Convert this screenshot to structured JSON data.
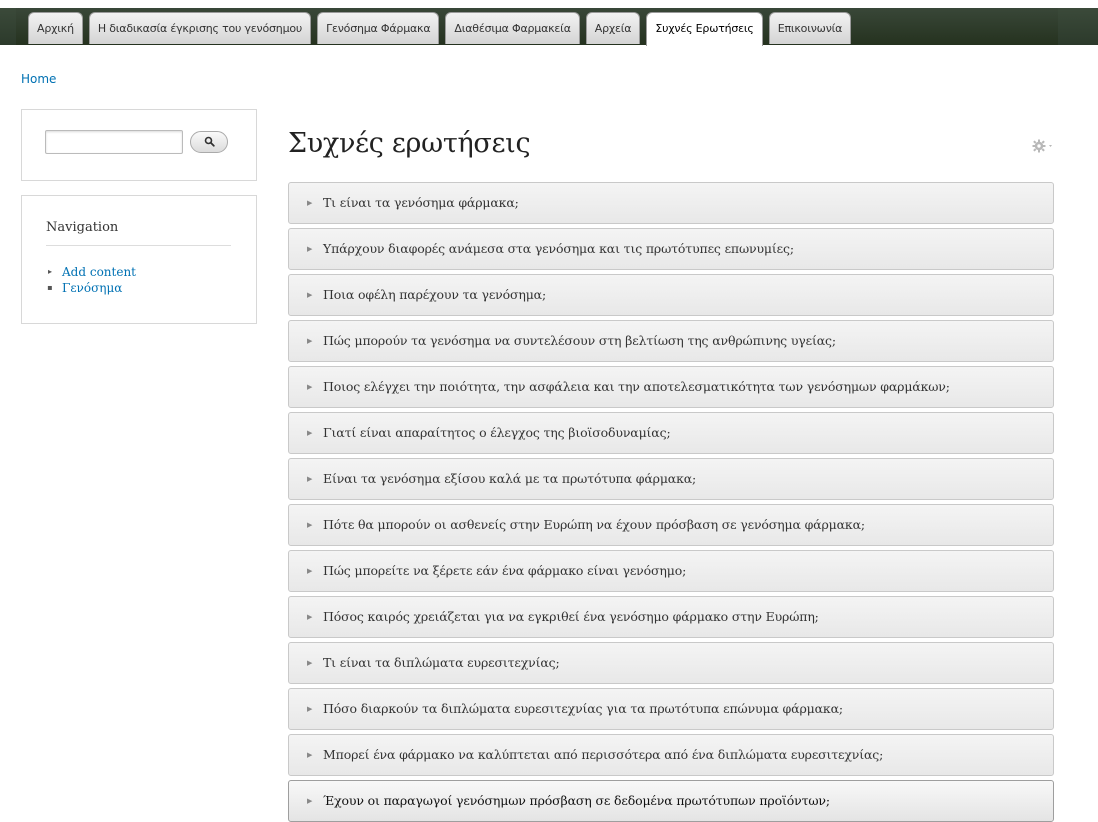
{
  "nav_tabs": [
    {
      "label": "Αρχική"
    },
    {
      "label": "Η διαδικασία έγκρισης του γενόσημου"
    },
    {
      "label": "Γενόσημα Φάρμακα"
    },
    {
      "label": "Διαθέσιμα Φαρμακεία"
    },
    {
      "label": "Αρχεία"
    },
    {
      "label": "Συχνές Ερωτήσεις"
    },
    {
      "label": "Επικοινωνία"
    }
  ],
  "active_tab": "Συχνές Ερωτήσεις",
  "breadcrumb": {
    "home": "Home"
  },
  "search": {
    "value": "",
    "button_icon": "search-icon"
  },
  "navigation": {
    "title": "Navigation",
    "items": [
      {
        "label": "Add content",
        "bullet": "▸"
      },
      {
        "label": "Γενόσημα",
        "bullet": "▪"
      }
    ]
  },
  "page": {
    "title": "Συχνές ερωτήσεις",
    "settings_icon": "gear-icon"
  },
  "faq": [
    {
      "question": "Τι είναι τα γενόσημα φάρμακα;"
    },
    {
      "question": "Υπάρχουν διαφορές ανάμεσα στα γενόσημα και τις πρωτότυπες επωνυμίες;"
    },
    {
      "question": "Ποια οφέλη παρέχουν τα γενόσημα;"
    },
    {
      "question": "Πώς μπορούν τα γενόσημα να συντελέσουν στη βελτίωση της ανθρώπινης υγείας;"
    },
    {
      "question": "Ποιος ελέγχει την ποιότητα, την ασφάλεια και την αποτελεσματικότητα των γενόσημων φαρμάκων;"
    },
    {
      "question": "Γιατί είναι απαραίτητος ο έλεγχος της βιοϊσοδυναμίας;"
    },
    {
      "question": "Είναι τα γενόσημα εξίσου καλά με τα πρωτότυπα φάρμακα;"
    },
    {
      "question": "Πότε θα μπορούν οι ασθενείς στην Ευρώπη να έχουν πρόσβαση σε γενόσημα φάρμακα;"
    },
    {
      "question": "Πώς μπορείτε να ξέρετε εάν ένα φάρμακο είναι γενόσημο;"
    },
    {
      "question": "Πόσος καιρός χρειάζεται για να εγκριθεί ένα γενόσημο φάρμακο στην Ευρώπη;"
    },
    {
      "question": "Τι είναι τα διπλώματα ευρεσιτεχνίας;"
    },
    {
      "question": "Πόσο διαρκούν τα διπλώματα ευρεσιτεχνίας για τα πρωτότυπα επώνυμα φάρμακα;"
    },
    {
      "question": "Μπορεί ένα φάρμακο να καλύπτεται από περισσότερα από ένα διπλώματα ευρεσιτεχνίας;"
    },
    {
      "question": "Έχουν οι παραγωγοί γενόσημων πρόσβαση σε δεδομένα πρωτότυπων προϊόντων;"
    }
  ],
  "colors": {
    "link": "#0071b3",
    "header_bg": "#2c3a2b",
    "faq_bg": "#eeeeee",
    "faq_border": "#c9c9c9"
  }
}
